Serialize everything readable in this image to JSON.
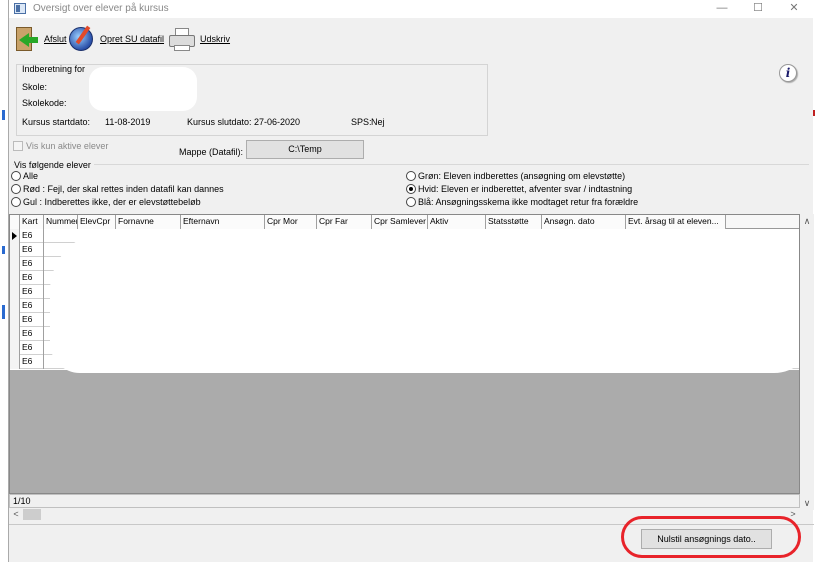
{
  "window": {
    "title": "Oversigt over elever på kursus",
    "controls": {
      "minimize": "—",
      "maximize": "☐",
      "close": "✕"
    }
  },
  "toolbar": {
    "exit_label": "Afslut",
    "create_label": "Opret SU datafil",
    "print_label": "Udskriv"
  },
  "report": {
    "legend": "Indberetning for",
    "school_label": "Skole:",
    "school_code_label": "Skolekode:",
    "start_label": "Kursus startdato:",
    "start_value": "11-08-2019",
    "end_label": "Kursus slutdato:",
    "end_value": "27-06-2020",
    "sps_label": "SPS:",
    "sps_value": "Nej"
  },
  "folder": {
    "label": "Mappe (Datafil):",
    "value": "C:\\Temp"
  },
  "active_only_label": "Vis kun aktive elever",
  "filter": {
    "legend": "Vis følgende elever",
    "options_left": [
      {
        "label": "Alle",
        "checked": false
      },
      {
        "label": "Rød : Fejl, der skal rettes inden datafil kan dannes",
        "checked": false
      },
      {
        "label": "Gul : Indberettes ikke, der er elevstøttebeløb",
        "checked": false
      }
    ],
    "options_right": [
      {
        "label": "Grøn: Eleven indberettes (ansøgning om elevstøtte)",
        "checked": false
      },
      {
        "label": "Hvid: Eleven er indberettet, afventer svar / indtastning",
        "checked": true
      },
      {
        "label": "Blå: Ansøgningsskema ikke modtaget retur fra forældre",
        "checked": false
      }
    ]
  },
  "grid": {
    "columns": [
      "Kart",
      "Nummer",
      "ElevCpr",
      "Fornavne",
      "Efternavn",
      "Cpr Mor",
      "Cpr Far",
      "Cpr Samlever",
      "Aktiv",
      "Statsstøtte",
      "Ansøgn. dato",
      "Evt. årsag til at eleven..."
    ],
    "rows": [
      "E6",
      "E6",
      "E6",
      "E6",
      "E6",
      "E6",
      "E6",
      "E6",
      "E6",
      "E6"
    ]
  },
  "status": {
    "record": "1/10"
  },
  "reset_button_label": "Nulstil ansøgnings dato..",
  "info_glyph": "i",
  "colors": {
    "highlight": "#e8232a",
    "grid_empty": "#ababab"
  }
}
